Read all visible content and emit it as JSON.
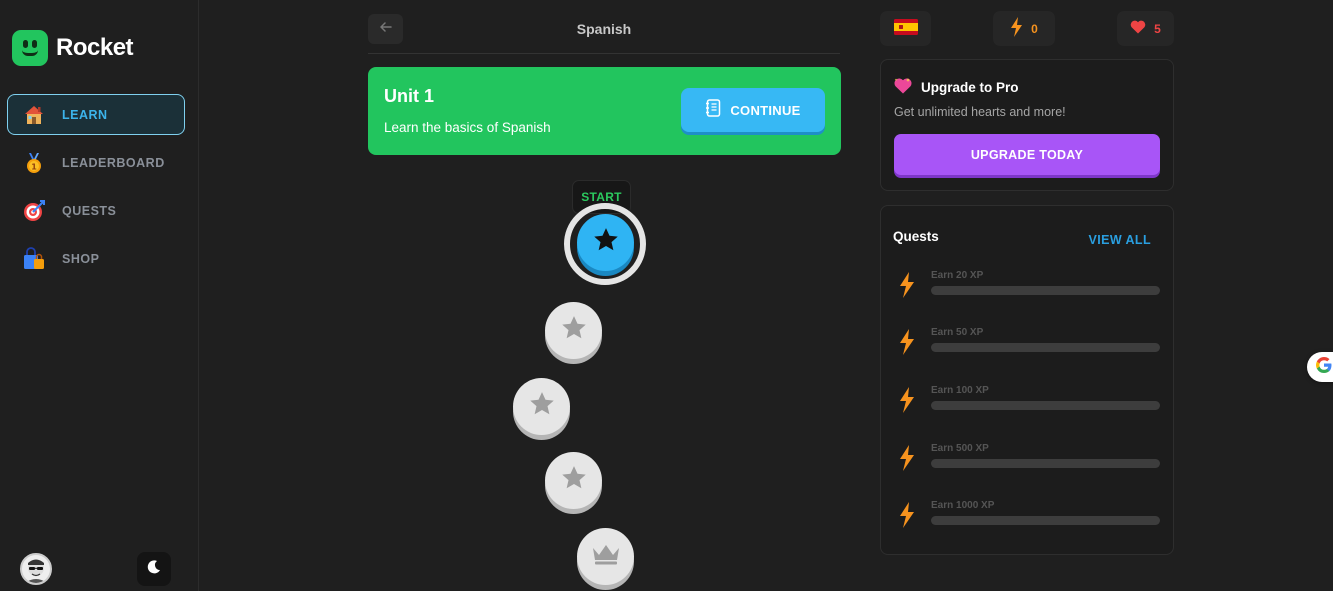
{
  "app": {
    "name": "Rocket"
  },
  "sidebar": {
    "items": [
      {
        "label": "LEARN",
        "icon": "house-icon",
        "active": true
      },
      {
        "label": "LEADERBOARD",
        "icon": "medal-icon",
        "active": false
      },
      {
        "label": "QUESTS",
        "icon": "target-icon",
        "active": false
      },
      {
        "label": "SHOP",
        "icon": "shopping-bag-icon",
        "active": false
      }
    ]
  },
  "header": {
    "course_title": "Spanish"
  },
  "unit": {
    "title": "Unit 1",
    "description": "Learn the basics of Spanish",
    "continue_label": "CONTINUE"
  },
  "path": {
    "start_label": "START",
    "lessons": [
      {
        "state": "current",
        "icon": "star-icon"
      },
      {
        "state": "locked",
        "icon": "star-icon"
      },
      {
        "state": "locked",
        "icon": "star-icon"
      },
      {
        "state": "locked",
        "icon": "star-icon"
      },
      {
        "state": "locked",
        "icon": "crown-icon"
      }
    ]
  },
  "stats": {
    "language_flag": "spain-flag-icon",
    "xp": "0",
    "hearts": "5"
  },
  "pro": {
    "title": "Upgrade to Pro",
    "description": "Get unlimited hearts and more!",
    "button_label": "UPGRADE TODAY"
  },
  "quests": {
    "title": "Quests",
    "view_all_label": "VIEW ALL",
    "items": [
      {
        "label": "Earn 20 XP",
        "progress": 0
      },
      {
        "label": "Earn 50 XP",
        "progress": 0
      },
      {
        "label": "Earn 100 XP",
        "progress": 0
      },
      {
        "label": "Earn 500 XP",
        "progress": 0
      },
      {
        "label": "Earn 1000 XP",
        "progress": 0
      }
    ]
  },
  "colors": {
    "brand_green": "#22c55e",
    "accent_blue": "#37b8f4",
    "pro_purple": "#a855f7",
    "xp_orange": "#f7931e",
    "heart_red": "#ef4444"
  }
}
